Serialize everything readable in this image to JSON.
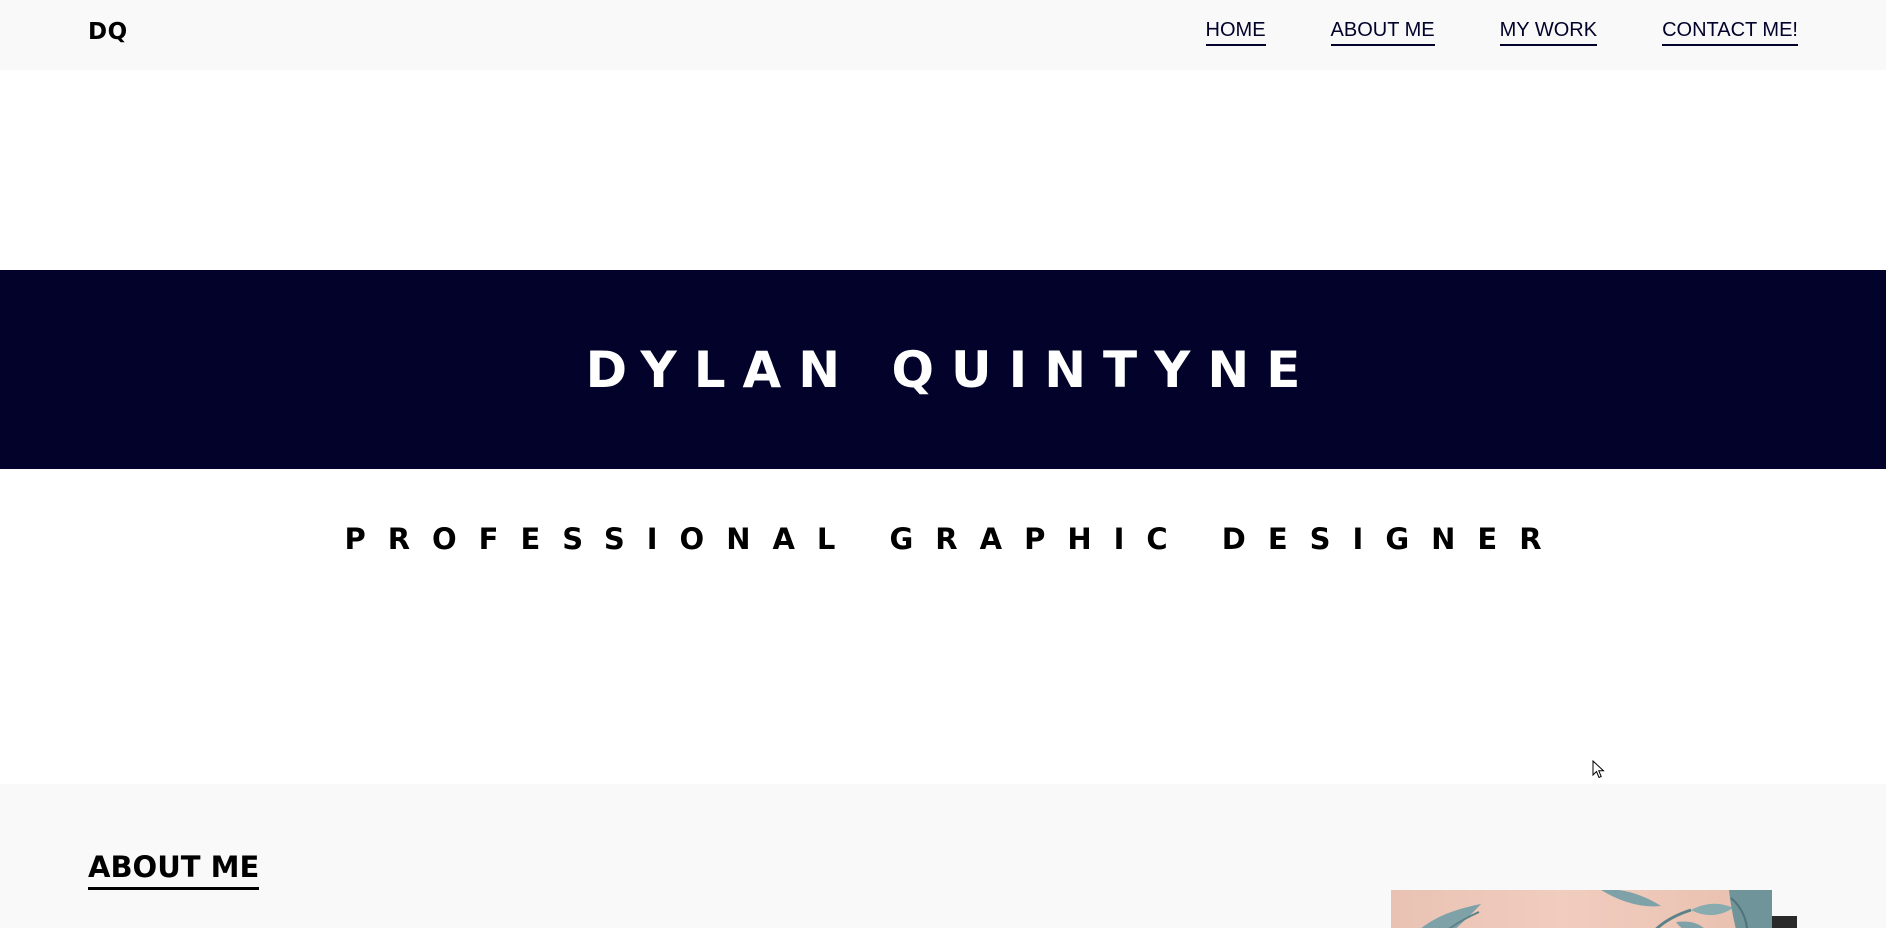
{
  "header": {
    "logo": "DQ",
    "nav": [
      {
        "label": "HOME"
      },
      {
        "label": "ABOUT ME"
      },
      {
        "label": "MY WORK"
      },
      {
        "label": "CONTACT ME!"
      }
    ]
  },
  "hero": {
    "title": "DYLAN QUINTYNE",
    "subtitle": "PROFESSIONAL GRAPHIC DESIGNER"
  },
  "about": {
    "heading": "ABOUT ME"
  },
  "colors": {
    "navy": "#02022a",
    "header_bg": "#f9f9f9",
    "section_bg": "#f9f9f9"
  }
}
